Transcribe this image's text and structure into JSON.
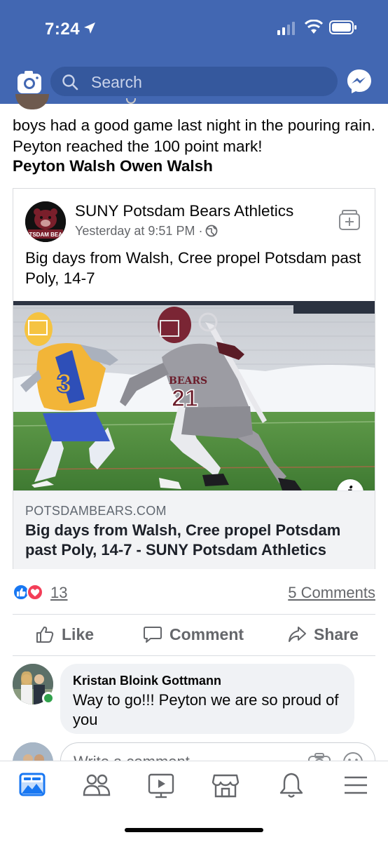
{
  "status_bar": {
    "time": "7:24"
  },
  "header": {
    "search": {
      "placeholder": "Search",
      "icon": "search-icon"
    },
    "left_icon": "camera-icon",
    "right_icon": "messenger-icon",
    "background": "#4267b2"
  },
  "post": {
    "text": "boys had a good game last night in the pouring rain. Peyton reached the 100 point mark!",
    "tags": "Peyton Walsh Owen Walsh",
    "shared": {
      "page_name": "SUNY Potsdam Bears Athletics",
      "time": "Yesterday at 9:51 PM ·",
      "privacy_icon": "globe-icon",
      "text": "Big days from Walsh, Cree propel Potsdam past Poly, 14-7",
      "avatar_badge": "POTSDAM BEARS",
      "photo": {
        "player_left_number": "3",
        "player_right_number": "21",
        "player_right_jersey_text": "BEARS"
      },
      "info_label": "i",
      "link": {
        "domain": "POTSDAMBEARS.COM",
        "title": "Big days from Walsh, Cree propel Potsdam past Poly, 14-7 - SUNY Potsdam Athletics"
      }
    },
    "reactions": {
      "count": "13",
      "comments": "5 Comments"
    },
    "actions": {
      "like": "Like",
      "comment": "Comment",
      "share": "Share"
    }
  },
  "comments": [
    {
      "author": "Kristan Bloink Gottmann",
      "text": "Way to go!!! Peyton we are so proud of you"
    }
  ],
  "write_comment": {
    "placeholder": "Write a comment..."
  },
  "tabs": [
    "news-feed-icon",
    "friends-icon",
    "watch-icon",
    "marketplace-icon",
    "notifications-icon",
    "menu-icon"
  ],
  "colors": {
    "brand": "#4267b2",
    "like_blue": "#1877f2",
    "love_red": "#f33e58",
    "online_green": "#31a24c"
  }
}
